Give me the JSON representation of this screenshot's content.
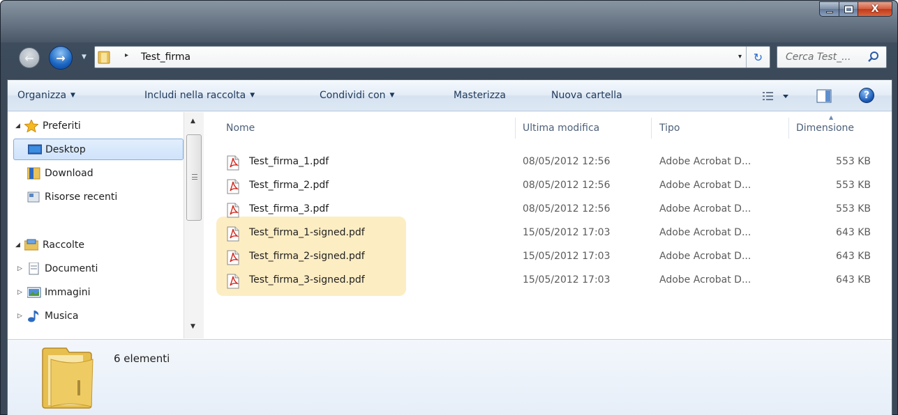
{
  "window": {
    "caption_buttons": [
      "minimize",
      "maximize",
      "close"
    ],
    "close_glyph": "X"
  },
  "address": {
    "path_separator": "▸",
    "current_folder": "Test_firma",
    "dropdown_glyph": "▾",
    "refresh_glyph": "↻"
  },
  "search": {
    "placeholder": "Cerca Test_..."
  },
  "toolbar": {
    "organize": "Organizza",
    "include": "Includi nella raccolta",
    "share": "Condividi con",
    "burn": "Masterizza",
    "new_folder": "Nuova cartella",
    "help": "?"
  },
  "nav": {
    "favorites": "Preferiti",
    "desktop": "Desktop",
    "download": "Download",
    "recent": "Risorse recenti",
    "libraries": "Raccolte",
    "documents": "Documenti",
    "pictures": "Immagini",
    "music": "Musica"
  },
  "columns": {
    "name": "Nome",
    "modified": "Ultima modifica",
    "type": "Tipo",
    "size": "Dimensione"
  },
  "files": [
    {
      "name": "Test_firma_1.pdf",
      "modified": "08/05/2012 12:56",
      "type": "Adobe Acrobat D...",
      "size": "553 KB"
    },
    {
      "name": "Test_firma_2.pdf",
      "modified": "08/05/2012 12:56",
      "type": "Adobe Acrobat D...",
      "size": "553 KB"
    },
    {
      "name": "Test_firma_3.pdf",
      "modified": "08/05/2012 12:56",
      "type": "Adobe Acrobat D...",
      "size": "553 KB"
    },
    {
      "name": "Test_firma_1-signed.pdf",
      "modified": "15/05/2012 17:03",
      "type": "Adobe Acrobat D...",
      "size": "643 KB"
    },
    {
      "name": "Test_firma_2-signed.pdf",
      "modified": "15/05/2012 17:03",
      "type": "Adobe Acrobat D...",
      "size": "643 KB"
    },
    {
      "name": "Test_firma_3-signed.pdf",
      "modified": "15/05/2012 17:03",
      "type": "Adobe Acrobat D...",
      "size": "643 KB"
    }
  ],
  "details": {
    "item_count": "6 elementi"
  },
  "colors": {
    "highlight": "#fdeab8",
    "selection": "#cfe3fb",
    "toolbar_text": "#1e395b"
  }
}
